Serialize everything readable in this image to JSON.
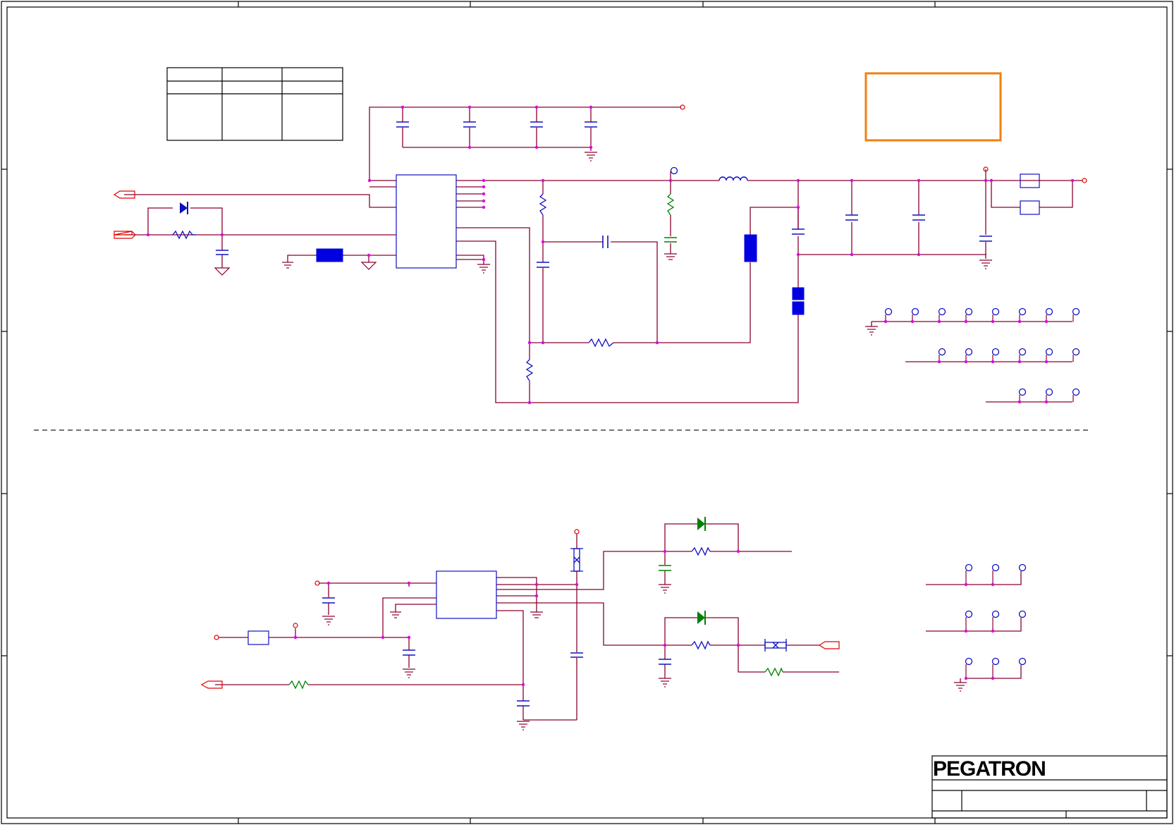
{
  "title_block": {
    "company": "PEGATRON",
    "title": "",
    "doc_number": "",
    "revision": "",
    "sheet": ""
  },
  "colors": {
    "wire": "#8b0030",
    "bus": "#800040",
    "component": "#1010c0",
    "pin_dot": "#e000e0",
    "connector": "#e00000",
    "accent_green": "#008000",
    "note_box": "#f08010",
    "frame": "#000000",
    "fill_blue": "#0000e0"
  },
  "option_table": {
    "headers": [
      "",
      "",
      ""
    ],
    "rows": [
      [
        "",
        "",
        ""
      ]
    ]
  },
  "note_box": {
    "text": ""
  }
}
